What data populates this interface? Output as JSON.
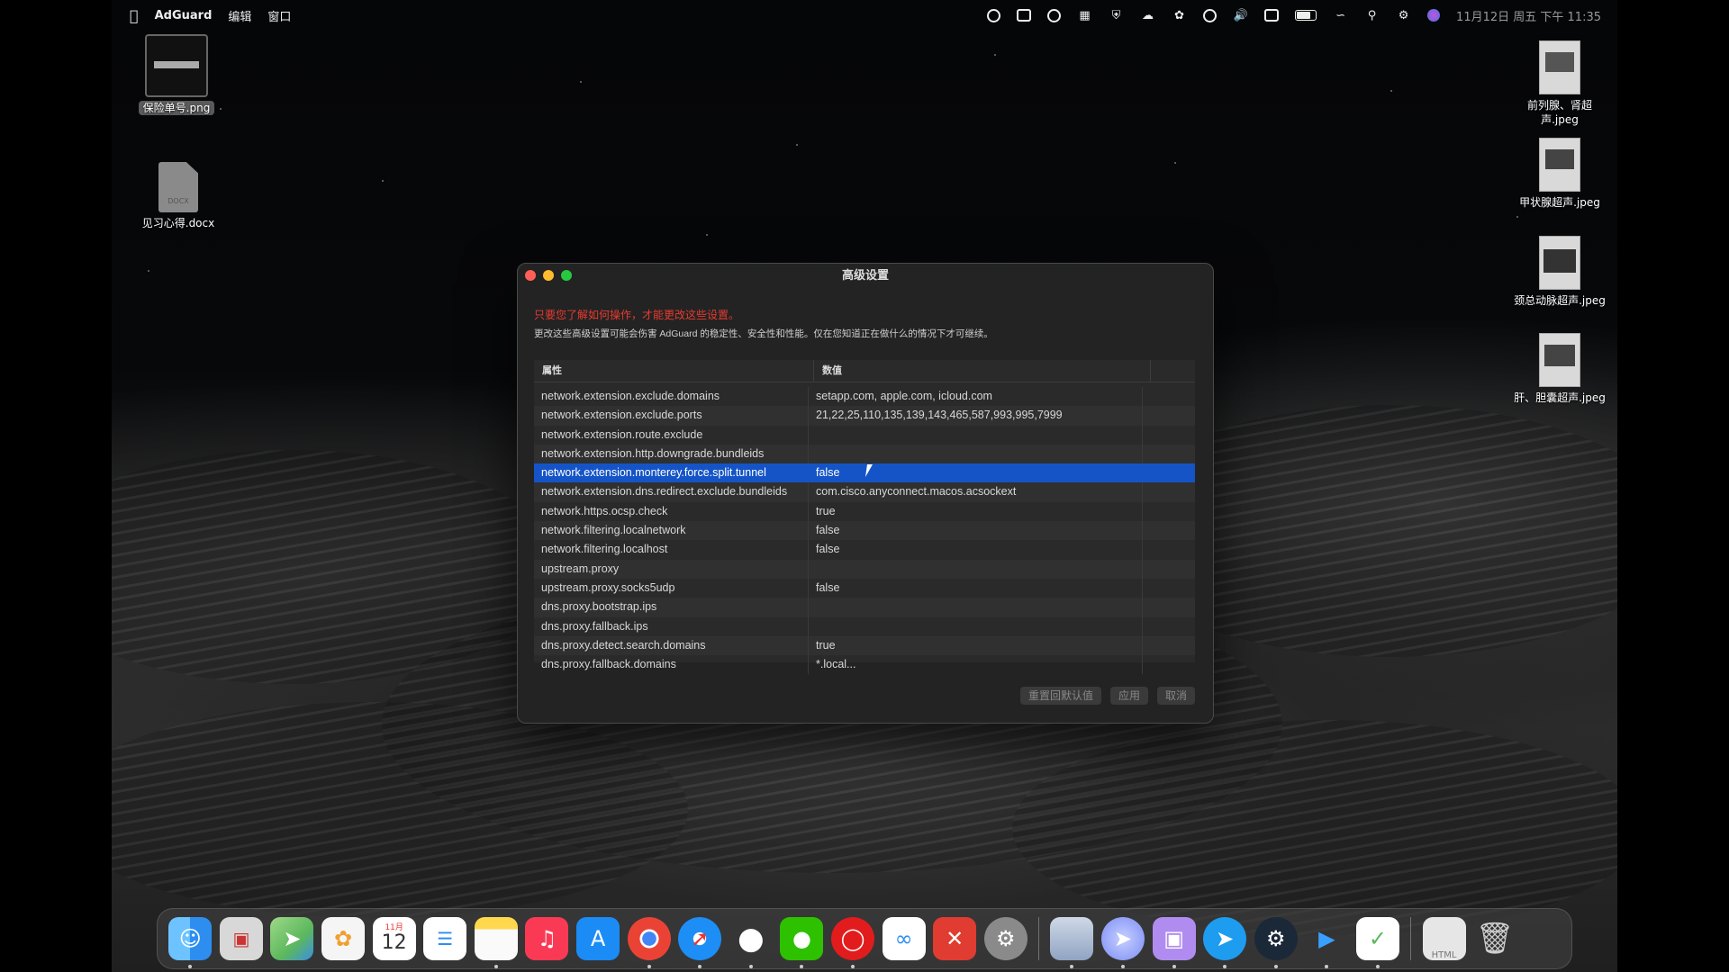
{
  "menubar": {
    "app_name": "AdGuard",
    "menus": [
      "编辑",
      "窗口"
    ],
    "clock": "11月12日 周五 下午 11:35"
  },
  "desktop_icons": [
    {
      "label": "保险单号.png",
      "selected": true
    },
    {
      "label": "见习心得.docx"
    },
    {
      "label": "前列腺、肾超声.jpeg"
    },
    {
      "label": "甲状腺超声.jpeg"
    },
    {
      "label": "颈总动脉超声.jpeg"
    },
    {
      "label": "肝、胆囊超声.jpeg"
    }
  ],
  "dialog": {
    "title": "高级设置",
    "warning": "只要您了解如何操作，才能更改这些设置。",
    "description": "更改这些高级设置可能会伤害 AdGuard 的稳定性、安全性和性能。仅在您知道正在做什么的情况下才可继续。",
    "columns": [
      "属性",
      "数值"
    ],
    "rows": [
      {
        "key": "network.extension.exclude.domains",
        "value": "setapp.com, apple.com, icloud.com"
      },
      {
        "key": "network.extension.exclude.ports",
        "value": "21,22,25,110,135,139,143,465,587,993,995,7999"
      },
      {
        "key": "network.extension.route.exclude",
        "value": ""
      },
      {
        "key": "network.extension.http.downgrade.bundleids",
        "value": ""
      },
      {
        "key": "network.extension.monterey.force.split.tunnel",
        "value": "false",
        "selected": true
      },
      {
        "key": "network.extension.dns.redirect.exclude.bundleids",
        "value": "com.cisco.anyconnect.macos.acsockext"
      },
      {
        "key": "network.https.ocsp.check",
        "value": "true"
      },
      {
        "key": "network.filtering.localnetwork",
        "value": "false"
      },
      {
        "key": "network.filtering.localhost",
        "value": "false"
      },
      {
        "key": "upstream.proxy",
        "value": ""
      },
      {
        "key": "upstream.proxy.socks5udp",
        "value": "false"
      },
      {
        "key": "dns.proxy.bootstrap.ips",
        "value": ""
      },
      {
        "key": "dns.proxy.fallback.ips",
        "value": ""
      },
      {
        "key": "dns.proxy.detect.search.domains",
        "value": "true"
      },
      {
        "key": "dns.proxy.fallback.domains",
        "value": "*.local..."
      }
    ],
    "buttons": {
      "reset": "重置回默认值",
      "apply": "应用",
      "cancel": "取消"
    }
  },
  "dock": {
    "calendar_month": "11月",
    "calendar_day": "12",
    "apps": [
      {
        "name": "finder-icon",
        "color": "#2d8ef0"
      },
      {
        "name": "launchpad-icon",
        "color": "#d8d8d8"
      },
      {
        "name": "maps-icon",
        "color": "#5cb85c"
      },
      {
        "name": "photos-icon",
        "color": "#f5f5f5"
      },
      {
        "name": "calendar-icon",
        "color": "#ffffff"
      },
      {
        "name": "reminders-icon",
        "color": "#ffffff"
      },
      {
        "name": "notes-icon",
        "color": "#ffd84d"
      },
      {
        "name": "music-icon",
        "color": "#fa3a55"
      },
      {
        "name": "app-store-icon",
        "color": "#1b8cf5"
      },
      {
        "name": "chrome-icon",
        "color": "#ffffff"
      },
      {
        "name": "safari-icon",
        "color": "#1c8ef5"
      },
      {
        "name": "qq-icon",
        "color": "#1a1a1a"
      },
      {
        "name": "wechat-icon",
        "color": "#2dc100"
      },
      {
        "name": "netease-music-icon",
        "color": "#e21c1c"
      },
      {
        "name": "baidu-netdisk-icon",
        "color": "#ffffff"
      },
      {
        "name": "xmind-icon",
        "color": "#e03c31"
      },
      {
        "name": "system-preferences-icon",
        "color": "#8a8a8a"
      },
      {
        "name": "preview-icon",
        "color": "#cfd8e6"
      },
      {
        "name": "paw-app-icon",
        "color": "#7a8cf5"
      },
      {
        "name": "simulator-icon",
        "color": "#b08cf0"
      },
      {
        "name": "ai-app-icon",
        "color": "#1e9cf0"
      },
      {
        "name": "steam-icon",
        "color": "#1b2838"
      },
      {
        "name": "infuse-icon",
        "color": "#1a1a1a"
      },
      {
        "name": "adguard-icon",
        "color": "#5cb85c"
      },
      {
        "name": "downloads-folder-icon",
        "color": "#e6e6e6"
      },
      {
        "name": "trash-icon",
        "color": "#cfcfcf"
      }
    ]
  }
}
